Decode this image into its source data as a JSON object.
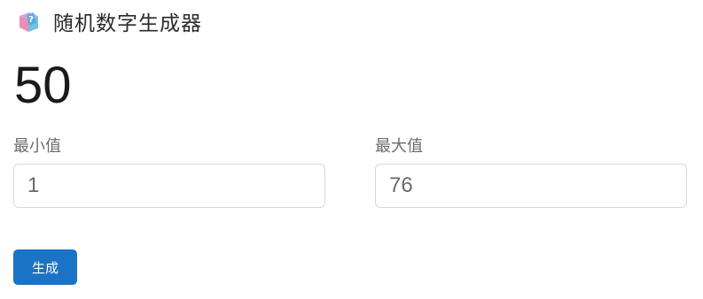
{
  "header": {
    "icon": "question-cube-icon",
    "title": "随机数字生成器"
  },
  "result": {
    "value": "50"
  },
  "min_field": {
    "label": "最小值",
    "value": "1"
  },
  "max_field": {
    "label": "最大值",
    "value": "76"
  },
  "actions": {
    "generate_label": "生成"
  },
  "colors": {
    "accent": "#1a73c4",
    "border": "#d8d8d8",
    "label_text": "#6b6b6b"
  }
}
